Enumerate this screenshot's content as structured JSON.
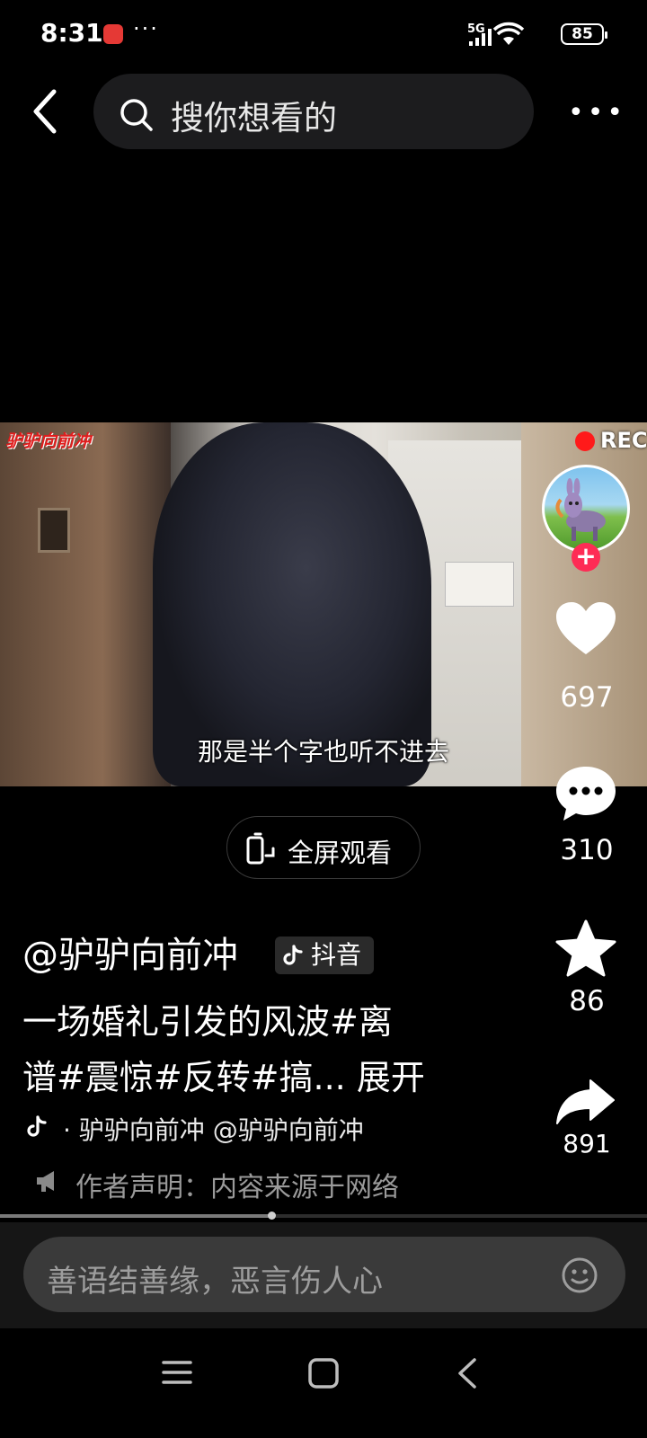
{
  "status_bar": {
    "time": "8:31",
    "more": "···",
    "network": "5G",
    "battery": "85"
  },
  "header": {
    "search_placeholder": "搜你想看的"
  },
  "video": {
    "watermark": "驴驴向前冲",
    "rec_label": "REC",
    "subtitle": "那是半个字也听不进去"
  },
  "actions": {
    "likes": "697",
    "comments": "310",
    "favorites": "86",
    "shares": "891"
  },
  "fullscreen": {
    "label": "全屏观看"
  },
  "info": {
    "author": "@驴驴向前冲",
    "platform": "抖音",
    "description_line1": "一场婚礼引发的风波#离",
    "description_line2": "谱#震惊#反转#搞... 展开",
    "music": "· 驴驴向前冲    @驴驴向前冲",
    "declaration": "作者声明：内容来源于网络"
  },
  "progress": {
    "fraction": 0.42
  },
  "comment": {
    "placeholder": "善语结善缘，恶言伤人心"
  },
  "colors": {
    "accent": "#fe2c55",
    "rec": "#ff1a1a",
    "watermark": "#e11d1d"
  }
}
